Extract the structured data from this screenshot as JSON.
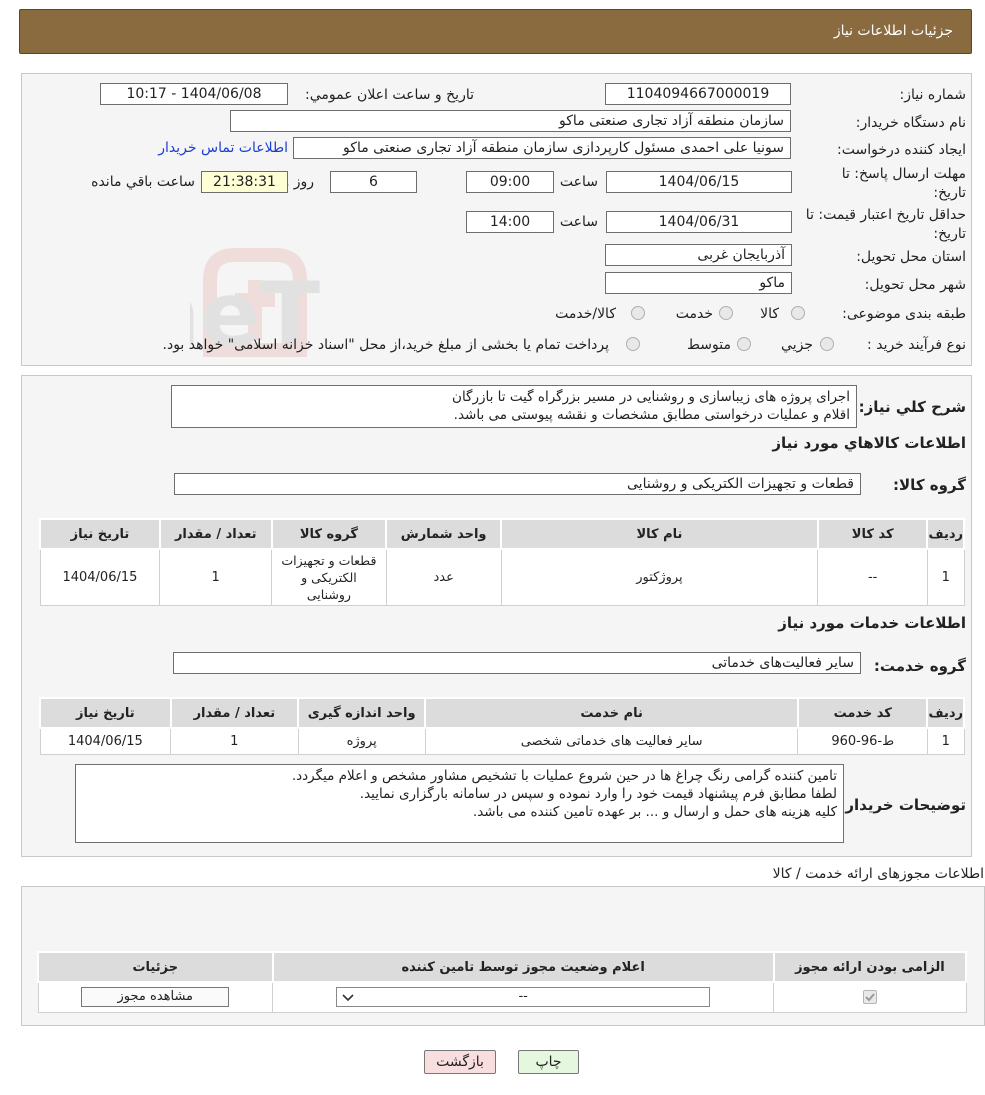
{
  "header": {
    "title": "جزئیات اطلاعات نیاز"
  },
  "info": {
    "need_number_label": "شماره نیاز:",
    "need_number": "1104094667000019",
    "announce_label": "تاریخ و ساعت اعلان عمومي:",
    "announce_value": "1404/06/08 - 10:17",
    "buyer_org_label": "نام دستگاه خریدار:",
    "buyer_org": "سازمان منطقه آزاد تجاری   صنعتی ماکو",
    "creator_label": "ایجاد کننده درخواست:",
    "creator": "سونیا علی احمدی مسئول کارپردازی سازمان منطقه آزاد تجاری   صنعتی ماکو",
    "contact_link": "اطلاعات تماس خریدار",
    "deadline_label": "مهلت ارسال پاسخ: تا تاریخ:",
    "deadline_date": "1404/06/15",
    "time_label": "ساعت",
    "deadline_time": "09:00",
    "days_value": "6",
    "days_label": "روز و",
    "remaining_time": "21:38:31",
    "remaining_label": "ساعت باقي مانده",
    "validity_label": "حداقل تاریخ اعتبار قیمت: تا تاریخ:",
    "validity_date": "1404/06/31",
    "validity_time": "14:00",
    "province_label": "استان محل تحویل:",
    "province": "آذربایجان غربی",
    "city_label": "شهر محل تحویل:",
    "city": "ماکو",
    "category_label": "طبقه بندی موضوعی:",
    "category_options": [
      "کالا",
      "خدمت",
      "کالا/خدمت"
    ],
    "process_label": "نوع فرآیند خرید :",
    "process_options": [
      "جزیي",
      "متوسط"
    ],
    "process_note": "پرداخت تمام یا بخشی از مبلغ خرید،از محل \"اسناد خزانه اسلامی\" خواهد بود."
  },
  "details": {
    "summary_label": "شرح کلي نیاز:",
    "summary_text": "اجرای پروژه های زیباسازی و روشنایی در مسیر بزرگراه گیت تا بازرگان\nاقلام و عملیات درخواستی مطابق مشخصات و نقشه پیوستی می باشد.",
    "goods_section": "اطلاعات کالاهاي مورد نياز",
    "goods_group_label": "گروه کالا:",
    "goods_group": "قطعات و تجهیزات الکتریکی و روشنایی",
    "goods_headers": [
      "ردیف",
      "کد کالا",
      "نام کالا",
      "واحد شمارش",
      "گروه کالا",
      "تعداد / مقدار",
      "تاریخ نیاز"
    ],
    "goods_rows": [
      [
        "1",
        "--",
        "پروژکتور",
        "عدد",
        "قطعات و تجهیزات الکتریکی و روشنایی",
        "1",
        "1404/06/15"
      ]
    ],
    "services_section": "اطلاعات خدمات مورد نياز",
    "service_group_label": "گروه خدمت:",
    "service_group": "سایر فعالیت‌های خدماتی",
    "service_headers": [
      "ردیف",
      "کد خدمت",
      "نام خدمت",
      "واحد اندازه گیری",
      "تعداد / مقدار",
      "تاریخ نیاز"
    ],
    "service_rows": [
      [
        "1",
        "ط-96-960",
        "سایر فعالیت های خدماتی شخصی",
        "پروژه",
        "1",
        "1404/06/15"
      ]
    ],
    "buyer_notes_label": "توضیحات خریدار:",
    "buyer_notes": "تامین کننده گرامی رنگ چراغ ها در حین شروع عملیات با تشخیص مشاور مشخص و اعلام میگردد.\nلطفا مطابق فرم پیشنهاد قیمت خود را وارد نموده و سپس در سامانه بارگزاری نمایید.\nکلیه هزینه های حمل و ارسال و ... بر عهده تامین کننده می باشد."
  },
  "permits": {
    "title": "اطلاعات مجوزهای ارائه خدمت / کالا",
    "headers": [
      "الزامی بودن ارائه مجوز",
      "اعلام وضعیت مجوز توسط تامین کننده",
      "جزئیات"
    ],
    "select_value": "--",
    "view_button": "مشاهده مجوز"
  },
  "actions": {
    "print": "چاپ",
    "back": "بازگشت"
  },
  "watermark": {
    "text": "AriaTender.neT"
  },
  "colors": {
    "header": "#8a6a3f",
    "link": "#1a3ecf",
    "back_button": "#f8dede",
    "print_button": "#e6f7e0",
    "remaining_bg": "#ffffd5"
  }
}
